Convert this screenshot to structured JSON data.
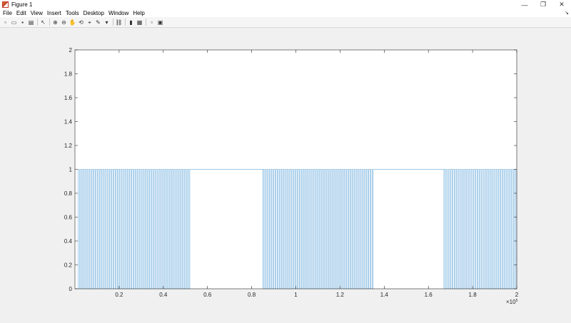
{
  "window": {
    "title": "Figure 1",
    "controls": {
      "minimize": "—",
      "restore": "❐",
      "close": "✕"
    }
  },
  "menu": [
    {
      "label": "File"
    },
    {
      "label": "Edit"
    },
    {
      "label": "View"
    },
    {
      "label": "Insert"
    },
    {
      "label": "Tools"
    },
    {
      "label": "Desktop"
    },
    {
      "label": "Window"
    },
    {
      "label": "Help"
    }
  ],
  "dock_arrow": "↘",
  "toolbar": {
    "icons": [
      "new-figure-icon",
      "open-file-icon",
      "save-icon",
      "print-icon",
      "edit-plot-arrow-icon",
      "zoom-in-icon",
      "zoom-out-icon",
      "pan-hand-icon",
      "rotate-3d-icon",
      "data-cursor-icon",
      "brush-icon",
      "brush-dropdown-icon",
      "link-plot-icon",
      "colorbar-icon",
      "legend-icon",
      "hide-plot-tools-icon",
      "show-plot-tools-icon"
    ],
    "glyphs": [
      "▫",
      "▭",
      "▪",
      "▤",
      "↖",
      "⊕",
      "⊖",
      "✋",
      "⟲",
      "⌖",
      "✎",
      "▾",
      "⛓",
      "▮",
      "▦",
      "▫",
      "▣"
    ]
  },
  "colors": {
    "line": "#7eb6e0",
    "axes": "#262626",
    "grid": "none"
  },
  "chart_data": {
    "type": "line",
    "style": "step",
    "x_multiplier_label": "×10",
    "x_multiplier_exp": "5",
    "xlim": [
      0,
      200000
    ],
    "ylim": [
      0,
      2
    ],
    "xticks": [
      20000,
      40000,
      60000,
      80000,
      100000,
      120000,
      140000,
      160000,
      180000,
      200000
    ],
    "xtick_labels": [
      "0.2",
      "0.4",
      "0.6",
      "0.8",
      "1",
      "1.2",
      "1.4",
      "1.6",
      "1.8",
      "2"
    ],
    "yticks": [
      0,
      0.2,
      0.4,
      0.6,
      0.8,
      1,
      1.2,
      1.4,
      1.6,
      1.8,
      2
    ],
    "ytick_labels": [
      "0",
      "0.2",
      "0.4",
      "0.6",
      "0.8",
      "1",
      "1.2",
      "1.4",
      "1.6",
      "1.8",
      "2"
    ],
    "pulse_bursts": [
      {
        "x_start": 1500,
        "x_end": 52000,
        "pulses": 50,
        "value_low": 0,
        "value_high": 1
      },
      {
        "x_start": 85000,
        "x_end": 135000,
        "pulses": 50,
        "value_low": 0,
        "value_high": 1
      },
      {
        "x_start": 167000,
        "x_end": 200000,
        "pulses": 32,
        "value_low": 0,
        "value_high": 1
      }
    ],
    "gaps_value": 1
  }
}
